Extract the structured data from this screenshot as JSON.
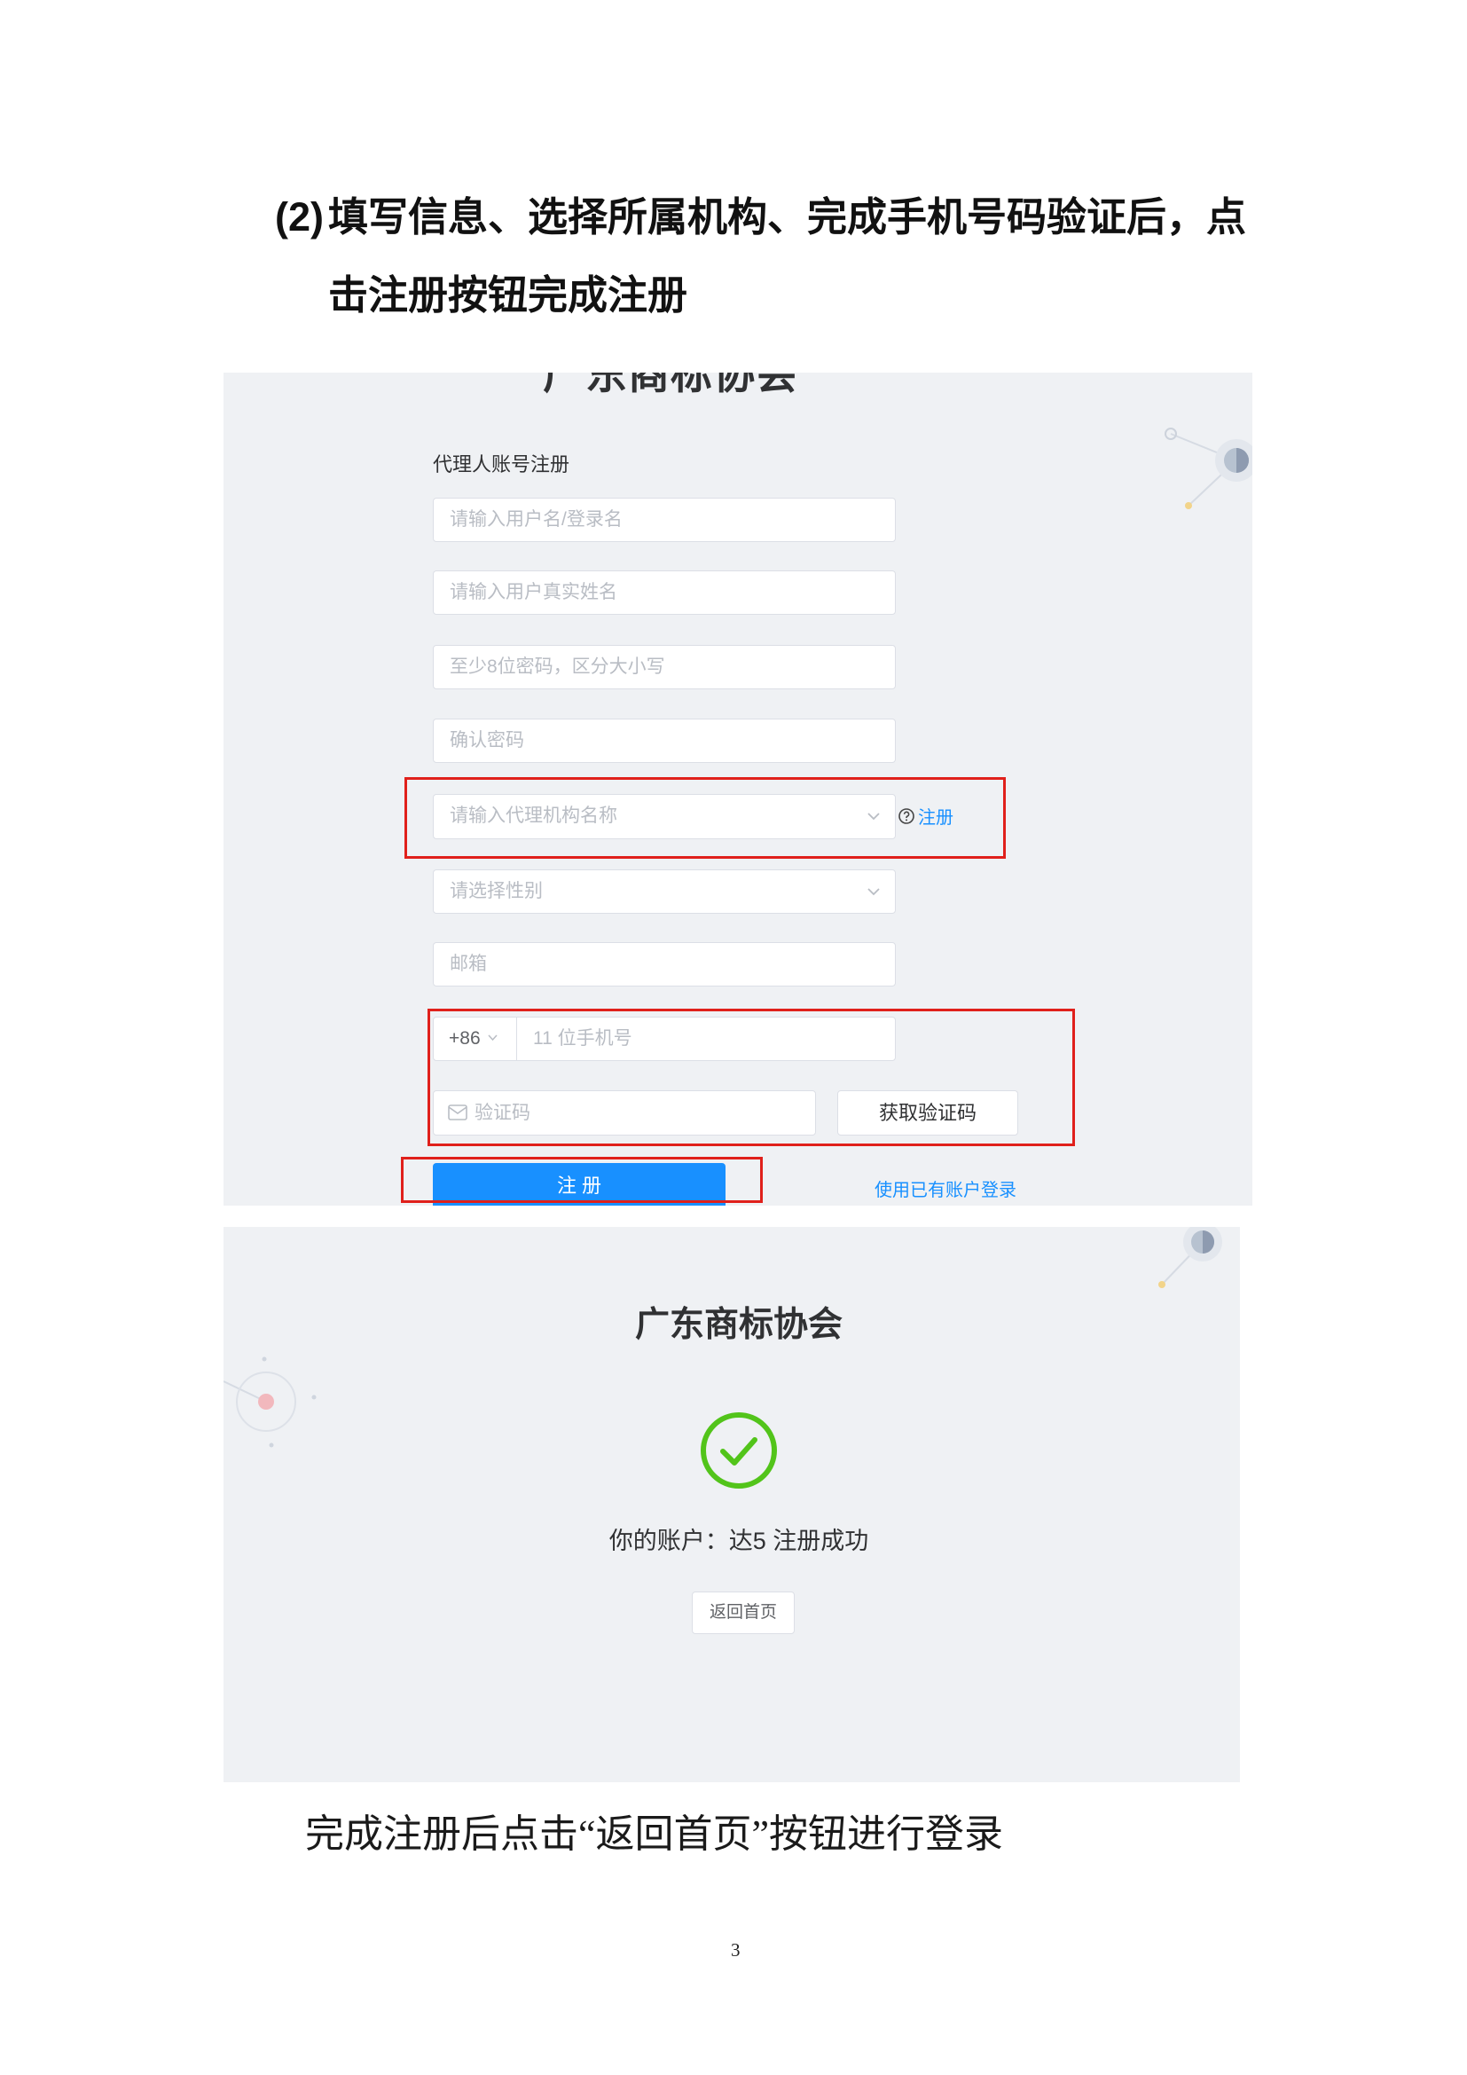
{
  "heading": {
    "number": "(2)",
    "line1": "填写信息、选择所属机构、完成手机号码验证后，点",
    "line2": "击注册按钮完成注册"
  },
  "register_screen": {
    "app_title": "广东商标协会",
    "form_title": "代理人账号注册",
    "fields": {
      "username_placeholder": "请输入用户名/登录名",
      "realname_placeholder": "请输入用户真实姓名",
      "password_placeholder": "至少8位密码，区分大小写",
      "confirm_password_placeholder": "确认密码",
      "agency_placeholder": "请输入代理机构名称",
      "gender_placeholder": "请选择性别",
      "email_placeholder": "邮箱",
      "phone_prefix": "+86",
      "phone_placeholder": "11 位手机号",
      "code_placeholder": "验证码"
    },
    "agency_register_link": "注册",
    "get_code_button": "获取验证码",
    "register_button": "注 册",
    "login_link": "使用已有账户登录"
  },
  "success_screen": {
    "app_title": "广东商标协会",
    "message": "你的账户：达5 注册成功",
    "home_button": "返回首页"
  },
  "caption": "完成注册后点击“返回首页”按钮进行登录",
  "page_number": "3",
  "colors": {
    "accent": "#1890ff",
    "highlight": "#e0201b",
    "success": "#52c41a",
    "panel_background": "#eff1f4"
  },
  "icons": [
    "chevron-down-icon",
    "question-circle-icon",
    "mail-icon",
    "check-circle-icon"
  ]
}
